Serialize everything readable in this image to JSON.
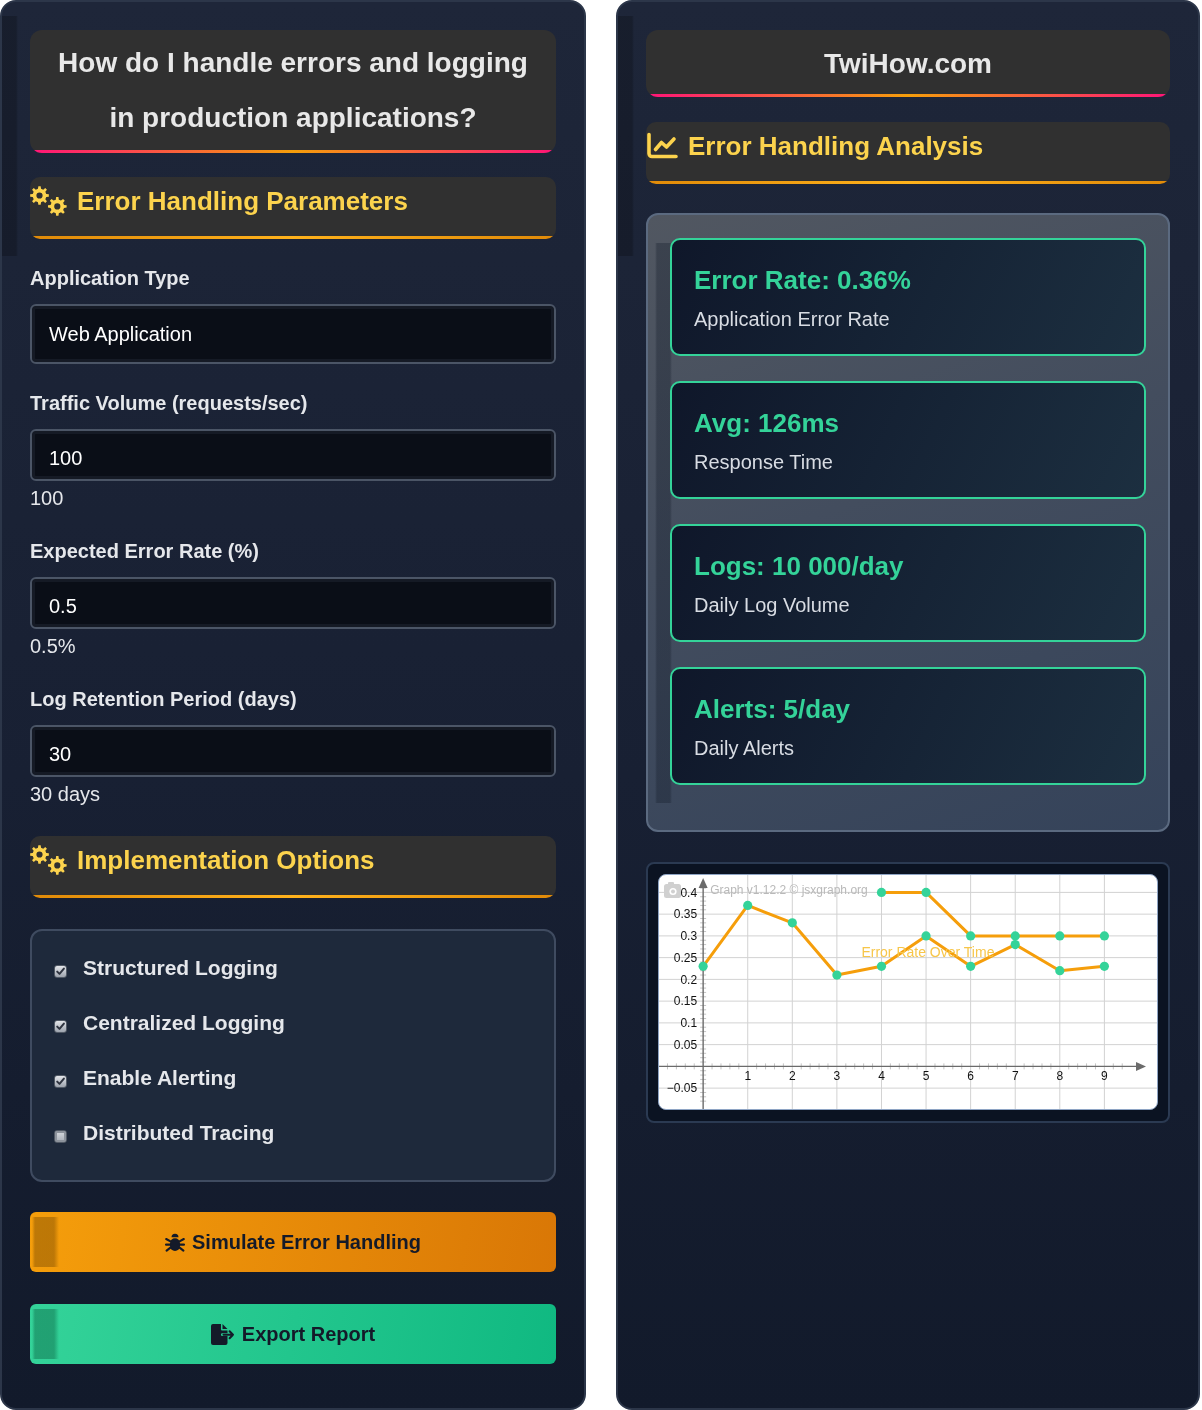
{
  "left_panel": {
    "title": "How do I handle errors and logging in production applications?",
    "parameters": {
      "header": {
        "kind": "settings",
        "title": "Error Handling Parameters"
      },
      "fields": [
        {
          "kind": "select",
          "label": "Application Type",
          "value": "Web Application"
        },
        {
          "kind": "number",
          "label": "Traffic Volume (requests/sec)",
          "value": "100",
          "readout": "100"
        },
        {
          "kind": "number",
          "label": "Expected Error Rate (%)",
          "value": "0.5",
          "readout": "0.5%"
        },
        {
          "kind": "number",
          "label": "Log Retention Period (days)",
          "value": "30",
          "readout": "30 days"
        }
      ]
    },
    "implementation": {
      "header": {
        "kind": "settings",
        "title": "Implementation Options"
      },
      "options": [
        {
          "label": "Structured Logging",
          "checked": true
        },
        {
          "label": "Centralized Logging",
          "checked": true
        },
        {
          "label": "Enable Alerting",
          "checked": true
        },
        {
          "label": "Distributed Tracing",
          "checked": false
        }
      ]
    },
    "buttons": [
      {
        "kind": "warning",
        "label": "Simulate Error Handling"
      },
      {
        "kind": "success",
        "label": "Export Report"
      }
    ]
  },
  "right_panel": {
    "title": "TwiHow.com",
    "analysis": {
      "header": {
        "kind": "analysis",
        "title": "Error Handling Analysis"
      },
      "stats": [
        {
          "value": "Error Rate: 0.36%",
          "label": "Application Error Rate"
        },
        {
          "value": "Avg: 126ms",
          "label": "Response Time"
        },
        {
          "value": "Logs: 10 000/day",
          "label": "Daily Log Volume"
        },
        {
          "value": "Alerts: 5/day",
          "label": "Daily Alerts"
        }
      ]
    },
    "chart": {
      "credit": "Graph v1.12.2 © jsxgraph.org",
      "chart_data": {
        "type": "line",
        "title": "Error Rate Over Time",
        "grid": true,
        "x": [
          0,
          1,
          2,
          3,
          4,
          5,
          6,
          7,
          8,
          9
        ],
        "series": [
          {
            "color": "#f59e0b",
            "marker": "circle",
            "values": [
              0.23,
              0.37,
              0.33,
              0.21,
              0.23,
              0.3,
              0.23,
              0.28,
              0.22,
              0.23
            ]
          },
          {
            "color": "#f59e0b",
            "marker": "circle",
            "values": [
              null,
              null,
              null,
              null,
              0.4,
              0.4,
              0.3,
              0.3,
              0.3,
              0.3
            ]
          }
        ],
        "xlim": [
          -0.99,
          10.18
        ],
        "ylim": [
          -0.098,
          0.44
        ],
        "xticks": [
          1,
          2,
          3,
          4,
          5,
          6,
          7,
          8,
          9
        ],
        "yticks": [
          {
            "value": -0.05,
            "label": "−0.05"
          },
          0.05,
          0.1,
          0.15,
          0.2,
          0.25,
          0.3,
          0.35,
          0.4
        ]
      }
    }
  }
}
